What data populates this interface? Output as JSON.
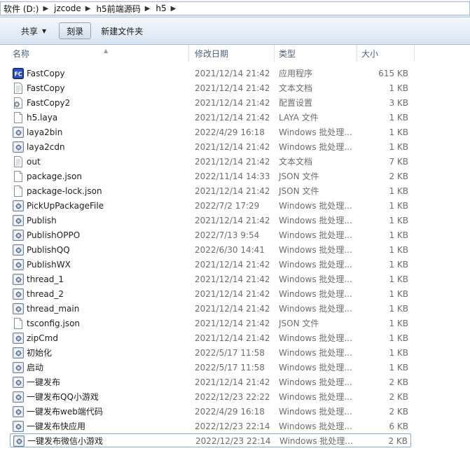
{
  "breadcrumb": [
    "软件 (D:)",
    "jzcode",
    "h5前端源码",
    "h5"
  ],
  "toolbar": {
    "share_label": "共享",
    "burn_label": "刻录",
    "new_folder_label": "新建文件夹"
  },
  "columns": {
    "name": "名称",
    "date": "修改日期",
    "type": "类型",
    "size": "大小"
  },
  "files": [
    {
      "name": "FastCopy",
      "date": "2021/12/14 21:42",
      "type": "应用程序",
      "size": "615 KB",
      "icon": "app-icon"
    },
    {
      "name": "FastCopy",
      "date": "2021/12/14 21:42",
      "type": "文本文档",
      "size": "1 KB",
      "icon": "text-doc-icon"
    },
    {
      "name": "FastCopy2",
      "date": "2021/12/14 21:42",
      "type": "配置设置",
      "size": "3 KB",
      "icon": "config-icon"
    },
    {
      "name": "h5.laya",
      "date": "2021/12/14 21:42",
      "type": "LAYA 文件",
      "size": "1 KB",
      "icon": "file-icon"
    },
    {
      "name": "laya2bin",
      "date": "2022/4/29 16:18",
      "type": "Windows 批处理...",
      "size": "1 KB",
      "icon": "batch-icon"
    },
    {
      "name": "laya2cdn",
      "date": "2021/12/14 21:42",
      "type": "Windows 批处理...",
      "size": "1 KB",
      "icon": "batch-icon"
    },
    {
      "name": "out",
      "date": "2021/12/14 21:42",
      "type": "文本文档",
      "size": "7 KB",
      "icon": "text-doc-icon"
    },
    {
      "name": "package.json",
      "date": "2022/11/14 14:33",
      "type": "JSON 文件",
      "size": "2 KB",
      "icon": "file-icon"
    },
    {
      "name": "package-lock.json",
      "date": "2021/12/14 21:42",
      "type": "JSON 文件",
      "size": "1 KB",
      "icon": "file-icon"
    },
    {
      "name": "PickUpPackageFile",
      "date": "2022/7/2 17:29",
      "type": "Windows 批处理...",
      "size": "1 KB",
      "icon": "batch-icon"
    },
    {
      "name": "Publish",
      "date": "2021/12/14 21:42",
      "type": "Windows 批处理...",
      "size": "1 KB",
      "icon": "batch-icon"
    },
    {
      "name": "PublishOPPO",
      "date": "2022/7/13 9:54",
      "type": "Windows 批处理...",
      "size": "1 KB",
      "icon": "batch-icon"
    },
    {
      "name": "PublishQQ",
      "date": "2022/6/30 14:41",
      "type": "Windows 批处理...",
      "size": "1 KB",
      "icon": "batch-icon"
    },
    {
      "name": "PublishWX",
      "date": "2021/12/14 21:42",
      "type": "Windows 批处理...",
      "size": "1 KB",
      "icon": "batch-icon"
    },
    {
      "name": "thread_1",
      "date": "2021/12/14 21:42",
      "type": "Windows 批处理...",
      "size": "1 KB",
      "icon": "batch-icon"
    },
    {
      "name": "thread_2",
      "date": "2021/12/14 21:42",
      "type": "Windows 批处理...",
      "size": "1 KB",
      "icon": "batch-icon"
    },
    {
      "name": "thread_main",
      "date": "2021/12/14 21:42",
      "type": "Windows 批处理...",
      "size": "1 KB",
      "icon": "batch-icon"
    },
    {
      "name": "tsconfig.json",
      "date": "2021/12/14 21:42",
      "type": "JSON 文件",
      "size": "1 KB",
      "icon": "file-icon"
    },
    {
      "name": "zipCmd",
      "date": "2021/12/14 21:42",
      "type": "Windows 批处理...",
      "size": "1 KB",
      "icon": "batch-icon"
    },
    {
      "name": "初始化",
      "date": "2022/5/17 11:58",
      "type": "Windows 批处理...",
      "size": "1 KB",
      "icon": "batch-icon"
    },
    {
      "name": "启动",
      "date": "2022/5/17 11:58",
      "type": "Windows 批处理...",
      "size": "1 KB",
      "icon": "batch-icon"
    },
    {
      "name": "一键发布",
      "date": "2021/12/14 21:42",
      "type": "Windows 批处理...",
      "size": "2 KB",
      "icon": "batch-icon"
    },
    {
      "name": "一键发布QQ小游戏",
      "date": "2022/12/23 22:22",
      "type": "Windows 批处理...",
      "size": "2 KB",
      "icon": "batch-icon"
    },
    {
      "name": "一键发布web端代码",
      "date": "2022/4/29 16:18",
      "type": "Windows 批处理...",
      "size": "2 KB",
      "icon": "batch-icon"
    },
    {
      "name": "一键发布快应用",
      "date": "2022/12/23 22:14",
      "type": "Windows 批处理...",
      "size": "6 KB",
      "icon": "batch-icon"
    },
    {
      "name": "一键发布微信小游戏",
      "date": "2022/12/23 22:14",
      "type": "Windows 批处理...",
      "size": "2 KB",
      "icon": "batch-icon",
      "selected": true
    }
  ]
}
